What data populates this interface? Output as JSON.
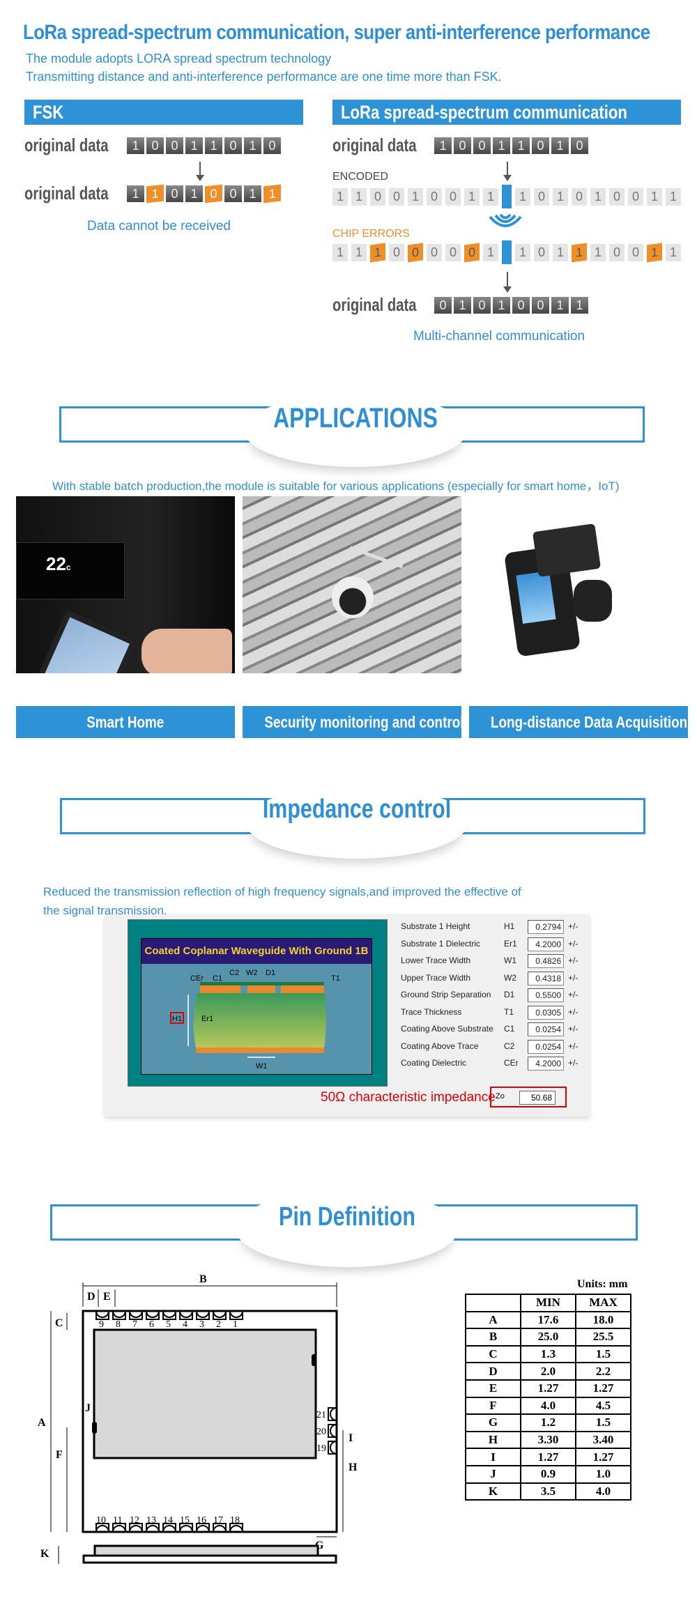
{
  "header": {
    "title": "LoRa spread-spectrum communication, super anti-interference performance",
    "intro_lines": [
      "The module adopts LORA spread spectrum technology",
      "Transmitting distance and anti-interference performance are one time more than FSK."
    ]
  },
  "fsk": {
    "heading": "FSK",
    "original_label": "original data",
    "original_bits": [
      "1",
      "0",
      "0",
      "1",
      "1",
      "0",
      "1",
      "0"
    ],
    "received_label": "original data",
    "received_bits": [
      {
        "v": "1",
        "err": false
      },
      {
        "v": "1",
        "err": true
      },
      {
        "v": "0",
        "err": false
      },
      {
        "v": "1",
        "err": false
      },
      {
        "v": "0",
        "err": true
      },
      {
        "v": "0",
        "err": false
      },
      {
        "v": "1",
        "err": false
      },
      {
        "v": "1",
        "err": true
      }
    ],
    "caption": "Data cannot be received"
  },
  "lora": {
    "heading": "LoRa spread-spectrum communication",
    "original_label": "original data",
    "original_bits": [
      "1",
      "0",
      "0",
      "1",
      "1",
      "0",
      "1",
      "0"
    ],
    "encoded_label": "ENCODED",
    "encoded_chips": [
      "1",
      "1",
      "0",
      "0",
      "1",
      "0",
      "0",
      "1",
      "1",
      "|",
      "1",
      "0",
      "1",
      "0",
      "1",
      "0",
      "0",
      "1",
      "1"
    ],
    "chip_errors_label": "CHIP ERRORS",
    "error_chips": [
      {
        "v": "1",
        "err": false
      },
      {
        "v": "1",
        "err": false
      },
      {
        "v": "1",
        "err": true
      },
      {
        "v": "0",
        "err": false
      },
      {
        "v": "0",
        "err": true
      },
      {
        "v": "0",
        "err": false
      },
      {
        "v": "0",
        "err": false
      },
      {
        "v": "0",
        "err": true
      },
      {
        "v": "1",
        "err": false
      },
      {
        "v": "|",
        "err": false
      },
      {
        "v": "1",
        "err": false
      },
      {
        "v": "0",
        "err": false
      },
      {
        "v": "1",
        "err": false
      },
      {
        "v": "1",
        "err": true
      },
      {
        "v": "1",
        "err": false
      },
      {
        "v": "0",
        "err": false
      },
      {
        "v": "0",
        "err": false
      },
      {
        "v": "1",
        "err": true
      },
      {
        "v": "1",
        "err": false
      }
    ],
    "recovered_label": "original data",
    "recovered_bits": [
      "0",
      "1",
      "0",
      "1",
      "0",
      "0",
      "1",
      "1"
    ],
    "caption": "Multi-channel communication"
  },
  "applications": {
    "title": "APPLICATIONS",
    "description": "With stable batch production,the module is suitable for various applications (especially for smart home，IoT)",
    "items": [
      {
        "label": "Smart Home"
      },
      {
        "label": "Security monitoring and control"
      },
      {
        "label": "Long-distance Data Acquisition"
      }
    ]
  },
  "impedance": {
    "title": "Impedance control",
    "description_lines": [
      "Reduced the transmission reflection of high frequency signals,and improved the effective of",
      "the signal transmission."
    ],
    "diagram_title": "Coated Coplanar Waveguide With Ground 1B",
    "diagram_labels": {
      "cer": "CEr",
      "c1": "C1",
      "c2": "C2",
      "w2": "W2",
      "d1": "D1",
      "t1": "T1",
      "h1": "H1",
      "er1": "Er1",
      "w1": "W1"
    },
    "params": [
      {
        "label": "Substrate 1 Height",
        "symbol": "H1",
        "value": "0.2794",
        "tol": "+/-"
      },
      {
        "label": "Substrate 1 Dielectric",
        "symbol": "Er1",
        "value": "4.2000",
        "tol": "+/-"
      },
      {
        "label": "Lower Trace Width",
        "symbol": "W1",
        "value": "0.4826",
        "tol": "+/-"
      },
      {
        "label": "Upper Trace Width",
        "symbol": "W2",
        "value": "0.4318",
        "tol": "+/-"
      },
      {
        "label": "Ground Strip Separation",
        "symbol": "D1",
        "value": "0.5500",
        "tol": "+/-"
      },
      {
        "label": "Trace Thickness",
        "symbol": "T1",
        "value": "0.0305",
        "tol": "+/-"
      },
      {
        "label": "Coating Above Substrate",
        "symbol": "C1",
        "value": "0.0254",
        "tol": "+/-"
      },
      {
        "label": "Coating Above Trace",
        "symbol": "C2",
        "value": "0.0254",
        "tol": "+/-"
      },
      {
        "label": "Coating Dielectric",
        "symbol": "CEr",
        "value": "4.2000",
        "tol": "+/-"
      }
    ],
    "result_label": "50Ω characteristic impedance",
    "result_symbol": "Zo",
    "result_value": "50.68"
  },
  "pins": {
    "title": "Pin Definition",
    "units": "Units: mm",
    "dim_labels": [
      "A",
      "B",
      "C",
      "D",
      "E",
      "F",
      "G",
      "H",
      "I",
      "J",
      "K"
    ],
    "top_pins": [
      "9",
      "8",
      "7",
      "6",
      "5",
      "4",
      "3",
      "2",
      "1"
    ],
    "bottom_pins": [
      "10",
      "11",
      "12",
      "13",
      "14",
      "15",
      "16",
      "17",
      "18"
    ],
    "side_pins": [
      "21",
      "20",
      "19"
    ],
    "table_headers": [
      "",
      "MIN",
      "MAX"
    ],
    "table_rows": [
      [
        "A",
        "17.6",
        "18.0"
      ],
      [
        "B",
        "25.0",
        "25.5"
      ],
      [
        "C",
        "1.3",
        "1.5"
      ],
      [
        "D",
        "2.0",
        "2.2"
      ],
      [
        "E",
        "1.27",
        "1.27"
      ],
      [
        "F",
        "4.0",
        "4.5"
      ],
      [
        "G",
        "1.2",
        "1.5"
      ],
      [
        "H",
        "3.30",
        "3.40"
      ],
      [
        "I",
        "1.27",
        "1.27"
      ],
      [
        "J",
        "0.9",
        "1.0"
      ],
      [
        "K",
        "3.5",
        "4.0"
      ]
    ]
  },
  "colors": {
    "accent": "#2e93d6",
    "error": "#ef8f2a",
    "highlight": "#e00000"
  }
}
